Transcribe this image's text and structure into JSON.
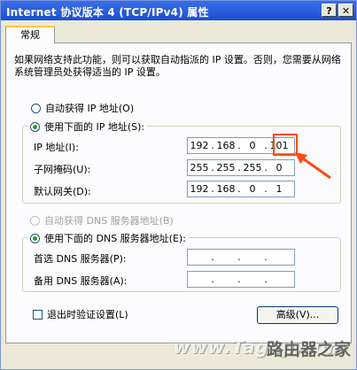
{
  "window": {
    "title": "Internet 协议版本 4 (TCP/IPv4) 属性",
    "help_glyph": "?",
    "close_glyph": "✕"
  },
  "tab": {
    "label": "常规"
  },
  "description": "如果网络支持此功能，则可以获取自动指派的 IP 设置。否则，您需要从网络系统管理员处获得适当的 IP 设置。",
  "ip_section": {
    "auto_label": "自动获得 IP 地址(O)",
    "manual_label": "使用下面的 IP 地址(S):",
    "selected": "manual",
    "ip_label": "IP 地址(I):",
    "ip_octets": [
      "192",
      "168",
      "0",
      "101"
    ],
    "mask_label": "子网掩码(U):",
    "mask_octets": [
      "255",
      "255",
      "255",
      "0"
    ],
    "gateway_label": "默认网关(D):",
    "gateway_octets": [
      "192",
      "168",
      "0",
      "1"
    ]
  },
  "dns_section": {
    "auto_label": "自动获得 DNS 服务器地址(B)",
    "manual_label": "使用下面的 DNS 服务器地址(E):",
    "selected": "manual",
    "preferred_label": "首选 DNS 服务器(P):",
    "preferred_octets": [
      "",
      "",
      "",
      ""
    ],
    "alternate_label": "备用 DNS 服务器(A):",
    "alternate_octets": [
      "",
      "",
      "",
      ""
    ]
  },
  "validate_label": "退出时验证设置(L)",
  "advanced_button": "高级(V)...",
  "annotation_color": "#ff4a10",
  "watermark": {
    "left": "www.Tagxp.com",
    "right": "路由器之家"
  }
}
